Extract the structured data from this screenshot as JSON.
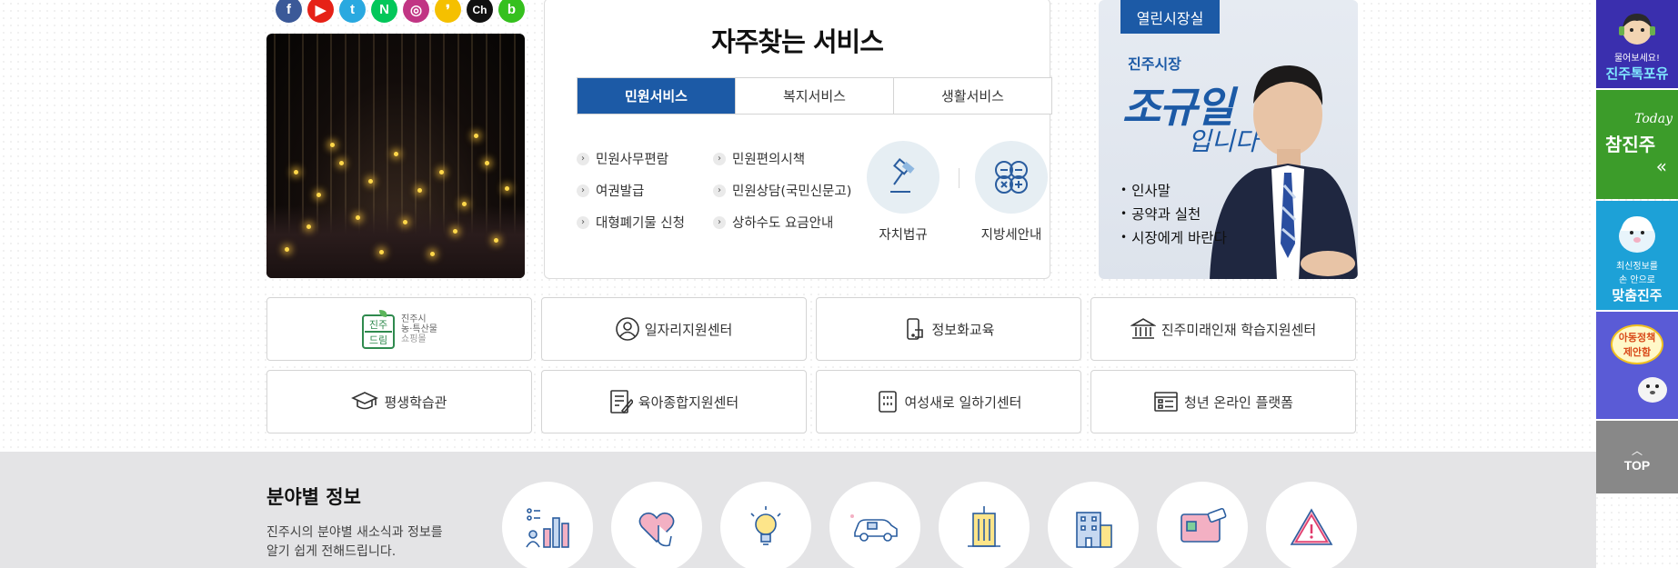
{
  "social": {
    "icons": [
      {
        "name": "facebook-icon",
        "glyph": "f",
        "color": "#3b5998"
      },
      {
        "name": "youtube-icon",
        "glyph": "▶",
        "color": "#e62117"
      },
      {
        "name": "twitter-icon",
        "glyph": "t",
        "color": "#2aa9e0"
      },
      {
        "name": "naver-icon",
        "glyph": "N",
        "color": "#03c75a"
      },
      {
        "name": "instagram-icon",
        "glyph": "◎",
        "color": "#c13584"
      },
      {
        "name": "kakaostory-icon",
        "glyph": "❜",
        "color": "#f5c000"
      },
      {
        "name": "kakao-channel-icon",
        "glyph": "Ch",
        "color": "#111111"
      },
      {
        "name": "band-icon",
        "glyph": "b",
        "color": "#35c01e"
      }
    ]
  },
  "services": {
    "title": "자주찾는 서비스",
    "tabs": [
      "민원서비스",
      "복지서비스",
      "생활서비스"
    ],
    "active_tab": 0,
    "links": [
      "민원사무편람",
      "민원편의시책",
      "여권발급",
      "민원상담(국민신문고)",
      "대형폐기물 신청",
      "상하수도 요금안내"
    ],
    "circles": [
      {
        "label": "자치법규",
        "icon": "gavel-icon"
      },
      {
        "label": "지방세안내",
        "icon": "calculator-icon"
      }
    ]
  },
  "mayor": {
    "tag": "열린시장실",
    "subtitle": "진주시장",
    "name": "조규일",
    "name_suffix": "입니다",
    "items": [
      "인사말",
      "공약과 실천",
      "시장에게 바란다"
    ]
  },
  "quick": {
    "brand": {
      "logo_text": "진주\n드림",
      "desc1": "진주시",
      "desc2": "농·특산물",
      "desc3": "쇼핑몰"
    },
    "buttons": [
      {
        "label": "일자리지원센터",
        "icon": "person-icon"
      },
      {
        "label": "정보화교육",
        "icon": "device-icon"
      },
      {
        "label": "진주미래인재 학습지원센터",
        "icon": "building-icon"
      },
      {
        "label": "평생학습관",
        "icon": "graduation-cap-icon"
      },
      {
        "label": "육아종합지원센터",
        "icon": "document-pen-icon"
      },
      {
        "label": "여성새로 일하기센터",
        "icon": "office-icon"
      },
      {
        "label": "청년 온라인 플랫폼",
        "icon": "list-board-icon"
      }
    ]
  },
  "fields": {
    "title": "분야별 정보",
    "desc_line1": "진주시의 분야별 새소식과 정보를",
    "desc_line2": "알기 쉽게 전해드립니다.",
    "categories": [
      "chart-person-icon",
      "heart-hand-icon",
      "lightbulb-icon",
      "car-icon",
      "city-building-icon",
      "apartment-icon",
      "wallet-card-icon",
      "warning-icon"
    ]
  },
  "side": {
    "talk_small": "물어보세요!",
    "talk_big": "진주톡포유",
    "today_small": "Today",
    "today_big": "참진주",
    "custom_small1": "최신정보를",
    "custom_small2": "손 안으로",
    "custom_big": "맞춤진주",
    "child_line1": "아동정책",
    "child_line2": "제안함",
    "top": "TOP"
  }
}
